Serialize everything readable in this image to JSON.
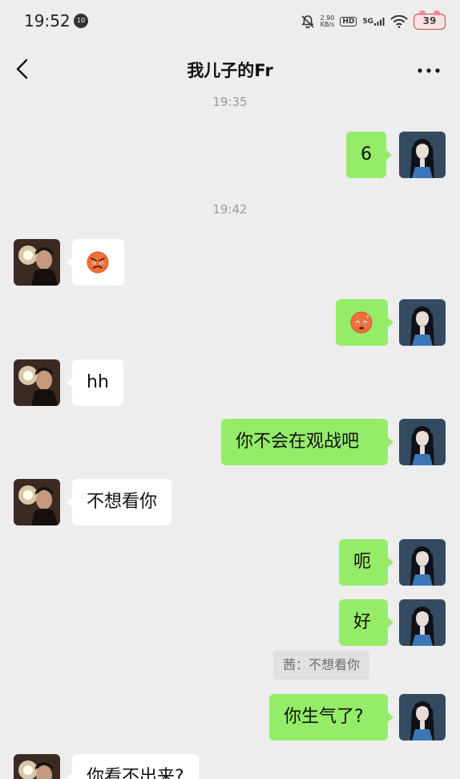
{
  "status_bar": {
    "time": "19:52",
    "notification_badge": "10",
    "net_speed": "2.90",
    "net_speed_unit": "KB/s",
    "hd_label": "HD",
    "network_label": "5G",
    "battery": "39"
  },
  "nav": {
    "title": "我儿子的Fr"
  },
  "messages": {
    "ts1": "19:35",
    "m1": "6",
    "ts2": "19:42",
    "m2_emoji": "angry-face-emoji",
    "m3_emoji": "sweat-face-emoji",
    "m4": "hh",
    "m5": "你不会在观战吧",
    "m6": "不想看你",
    "m7": "呃",
    "m8": "好",
    "quote": "茜：不想看你",
    "m9": "你生气了?",
    "m10": "你看不出来?"
  },
  "colors": {
    "background": "#ededed",
    "outgoing_bubble": "#95ec69",
    "incoming_bubble": "#ffffff",
    "timestamp_text": "#9a9a9a"
  }
}
